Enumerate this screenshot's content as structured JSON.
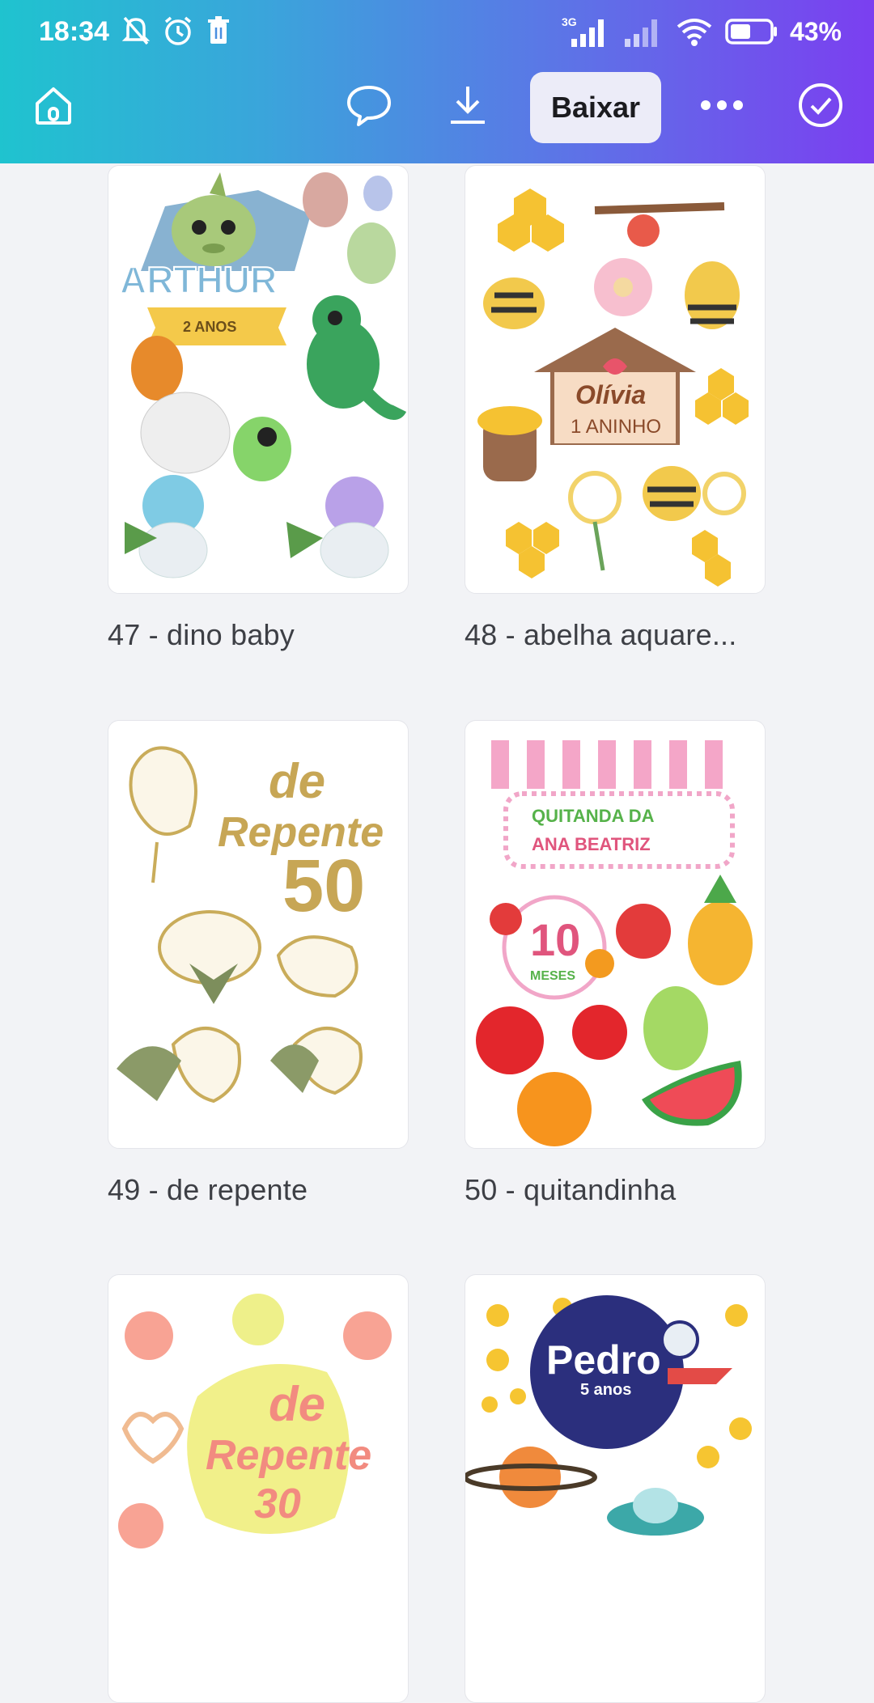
{
  "status": {
    "time": "18:34",
    "battery": "43%",
    "network": "3G"
  },
  "toolbar": {
    "download_label": "Baixar"
  },
  "templates": [
    {
      "title": "47 - dino baby",
      "art": {
        "name": "ARTHUR",
        "subtitle": "2 ANOS"
      }
    },
    {
      "title": "48 - abelha aquare...",
      "art": {
        "name": "Olívia",
        "subtitle": "1 ANINHO"
      }
    },
    {
      "title": "49 - de repente",
      "art": {
        "line1": "de",
        "line2": "Repente",
        "line3": "50"
      }
    },
    {
      "title": "50 - quitandinha",
      "art": {
        "line1": "QUITANDA DA",
        "line2": "ANA BEATRIZ",
        "age": "10",
        "age_unit": "MESES"
      }
    },
    {
      "title": "",
      "art": {
        "line1": "de",
        "line2": "Repente",
        "line3": "30"
      }
    },
    {
      "title": "",
      "art": {
        "name": "Pedro",
        "subtitle": "5 anos"
      }
    }
  ],
  "colors": {
    "brand_start": "#1fc3cf",
    "brand_end": "#7b3ff0"
  }
}
